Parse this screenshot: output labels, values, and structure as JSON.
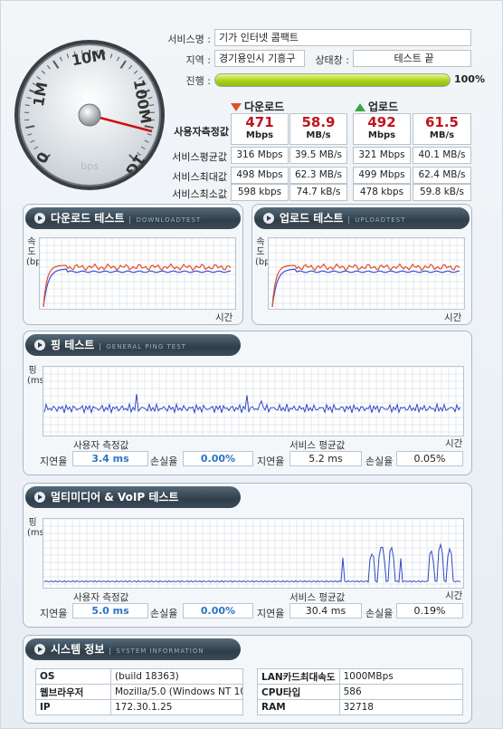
{
  "gauge": {
    "ticks": [
      "0",
      "1M",
      "10M",
      "100M",
      "1G"
    ],
    "small_ticks": [
      "bps"
    ],
    "unit": "bps",
    "needle_label": "speed-needle"
  },
  "info": {
    "service_name_label": "서비스명 :",
    "service_name": "기가 인터넷 콤팩트",
    "region_label": "지역 :",
    "region": "경기용인시 기흥구",
    "status_label": "상태창 :",
    "status": "테스트 끝",
    "progress_label": "진행 :",
    "progress_pct": "100%",
    "progress_value": 1.0
  },
  "speeds": {
    "download_title": "다운로드",
    "upload_title": "업로드",
    "measured_label": "사용자측정값",
    "download_mbps": "471",
    "download_mbps_unit": "Mbps",
    "download_mbs": "58.9",
    "download_mbs_unit": "MB/s",
    "upload_mbps": "492",
    "upload_mbps_unit": "Mbps",
    "upload_mbs": "61.5",
    "upload_mbs_unit": "MB/s",
    "rows": [
      {
        "label": "서비스평균값",
        "dl_a": "316 Mbps",
        "dl_b": "39.5 MB/s",
        "ul_a": "321 Mbps",
        "ul_b": "40.1 MB/s"
      },
      {
        "label": "서비스최대값",
        "dl_a": "498 Mbps",
        "dl_b": "62.3 MB/s",
        "ul_a": "499 Mbps",
        "ul_b": "62.4 MB/s"
      },
      {
        "label": "서비스최소값",
        "dl_a": "598 kbps",
        "dl_b": "74.7 kB/s",
        "ul_a": "478 kbps",
        "ul_b": "59.8 kB/s"
      }
    ]
  },
  "download_test": {
    "title": "다운로드 테스트",
    "subtitle": "DOWNLOADTEST",
    "ylabel": "속도(bps)",
    "xlabel": "시간"
  },
  "upload_test": {
    "title": "업로드 테스트",
    "subtitle": "UPLOADTEST",
    "ylabel": "속도(bps)",
    "xlabel": "시간"
  },
  "ping_test": {
    "title": "핑 테스트",
    "subtitle": "GENERAL PING TEST",
    "ylabel": "핑(ms)",
    "xlabel": "시간",
    "user_label": "사용자 측정값",
    "service_label": "서비스 평균값",
    "latency_label": "지연율",
    "loss_label": "손실율",
    "user_latency": "3.4 ms",
    "user_loss": "0.00%",
    "service_latency": "5.2 ms",
    "service_loss": "0.05%"
  },
  "voip_test": {
    "title": "멀티미디어 & VoIP 테스트",
    "ylabel": "핑(ms)",
    "xlabel": "시간",
    "user_label": "사용자 측정값",
    "service_label": "서비스 평균값",
    "latency_label": "지연율",
    "loss_label": "손실율",
    "user_latency": "5.0 ms",
    "user_loss": "0.00%",
    "service_latency": "30.4 ms",
    "service_loss": "0.19%"
  },
  "system_info": {
    "title": "시스템 정보",
    "subtitle": "SYSTEM INFORMATION",
    "left": [
      {
        "k": "OS",
        "v": "(build 18363)"
      },
      {
        "k": "웹브라우저",
        "v": "Mozilla/5.0 (Windows NT 10."
      },
      {
        "k": "IP",
        "v": "172.30.1.25"
      }
    ],
    "right": [
      {
        "k": "LAN카드최대속도",
        "v": "1000MBps"
      },
      {
        "k": "CPU타입",
        "v": "586"
      },
      {
        "k": "RAM",
        "v": "32718"
      }
    ]
  },
  "colors": {
    "download_line": "#e0502a",
    "upload_line": "#3a4fd1",
    "ping_line": "#2f49c9",
    "measured_red": "#c0151e",
    "accent_blue": "#2b74c4",
    "progress_green": "#a9d21b"
  }
}
